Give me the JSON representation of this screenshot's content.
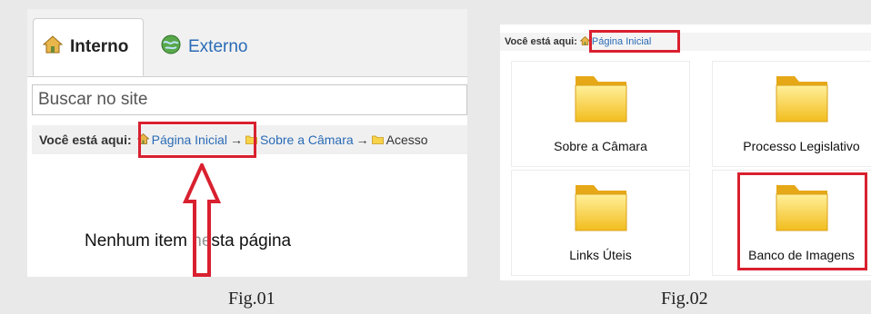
{
  "fig01": {
    "tabs": [
      {
        "label": "Interno",
        "active": true,
        "icon": "house-icon"
      },
      {
        "label": "Externo",
        "active": false,
        "icon": "globe-icon"
      }
    ],
    "search": {
      "placeholder": "Buscar no site"
    },
    "breadcrumb": {
      "prefix": "Você está aqui:",
      "home": "Página Inicial",
      "separator": "→",
      "items": [
        "Sobre a Câmara",
        "Acesso"
      ]
    },
    "empty_message": "Nenhum item nesta página",
    "caption": "Fig.01"
  },
  "fig02": {
    "breadcrumb": {
      "prefix": "Você está aqui:",
      "home": "Página Inicial"
    },
    "folders": [
      {
        "label": "Sobre a Câmara"
      },
      {
        "label": "Processo Legislativo"
      },
      {
        "label": "Links Úteis"
      },
      {
        "label": "Banco de Imagens"
      }
    ],
    "caption": "Fig.02"
  },
  "colors": {
    "highlight": "#d9202f",
    "link": "#2a6bb6",
    "folder": "#f7c92e"
  }
}
